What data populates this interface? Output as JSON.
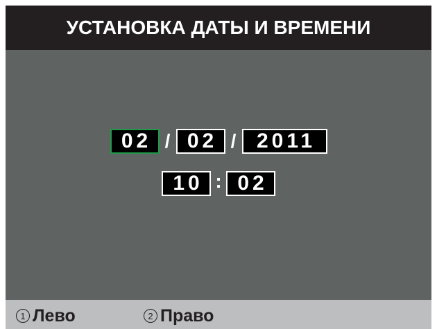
{
  "header": {
    "title": "УСТАНОВКА ДАТЫ И ВРЕМЕНИ"
  },
  "date": {
    "day": "02",
    "month": "02",
    "year": "2011",
    "separator": "/"
  },
  "time": {
    "hour": "10",
    "minute": "02",
    "separator": ":"
  },
  "selected_field": "day",
  "footer": {
    "left": {
      "number": "1",
      "label": "Лево"
    },
    "right": {
      "number": "2",
      "label": "Право"
    }
  },
  "colors": {
    "background": "#5f6362",
    "title_bar": "#231f20",
    "field_bg": "#000000",
    "selected_border": "#1e9a4a",
    "footer_bg": "#bcbec0"
  }
}
